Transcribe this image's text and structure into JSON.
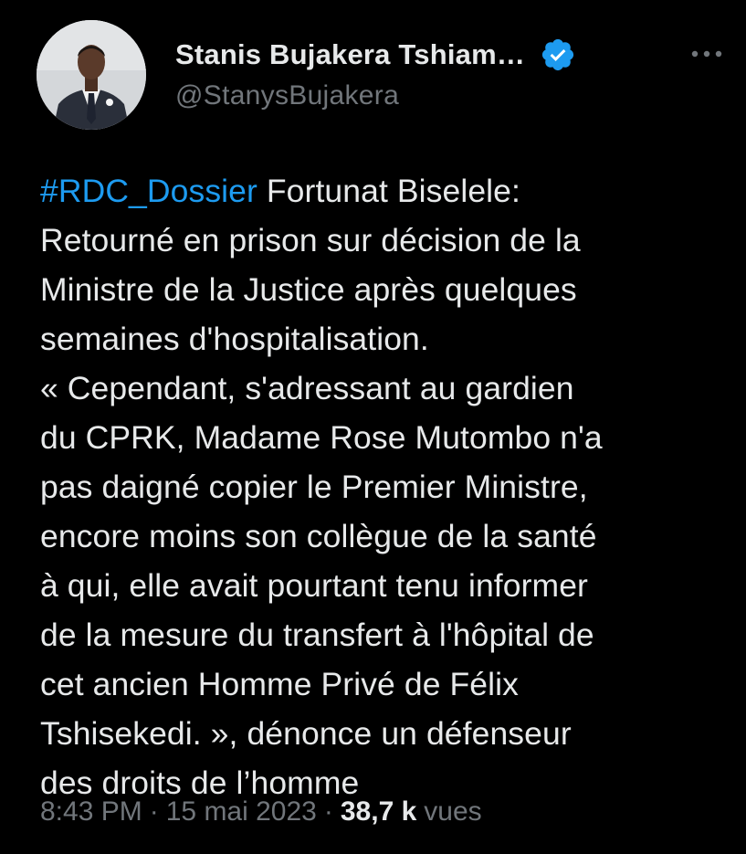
{
  "author": {
    "display_name": "Stanis Bujakera Tshiam…",
    "handle": "@StanysBujakera",
    "verified": true,
    "verified_icon": "verified-badge-icon",
    "avatar_icon": "profile-photo"
  },
  "more_icon": "more-options-icon",
  "tweet": {
    "hashtag": "#RDC_Dossier",
    "body": " Fortunat Biselele:\nRetourné en prison sur décision de la\nMinistre de la Justice après quelques\nsemaines d'hospitalisation.\n« Cependant, s'adressant au gardien\ndu CPRK, Madame Rose Mutombo n'a\npas daigné copier le Premier Ministre,\nencore moins son collègue de la santé\nà qui, elle avait pourtant tenu informer\nde la mesure du transfert à l'hôpital de\ncet ancien Homme Privé de Félix\nTshisekedi. », dénonce un défenseur\ndes droits de l’homme"
  },
  "meta": {
    "time": "8:43 PM",
    "separator": "·",
    "date": "15 mai 2023",
    "views_count": "38,7 k",
    "views_label": "vues"
  },
  "colors": {
    "background": "#000000",
    "text": "#e7e9ea",
    "secondary": "#71767b",
    "link": "#1d9bf0"
  }
}
